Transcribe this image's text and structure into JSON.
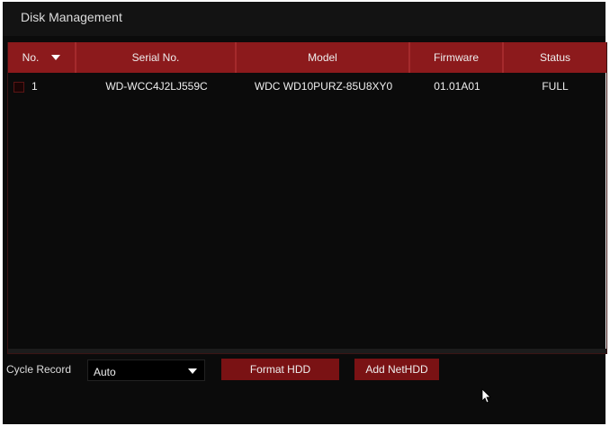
{
  "title": "Disk Management",
  "table": {
    "columns": [
      "No.",
      "Serial No.",
      "Model",
      "Firmware",
      "Status"
    ],
    "rows": [
      {
        "no": "1",
        "serial": "WD-WCC4J2LJ559C",
        "model": "WDC WD10PURZ-85U8XY0",
        "firmware": "01.01A01",
        "status": "FULL"
      }
    ]
  },
  "controls": {
    "cycle_record_label": "Cycle Record",
    "cycle_record_value": "Auto",
    "format_label": "Format HDD",
    "add_nethdd_label": "Add NetHDD"
  },
  "colors": {
    "accent": "#8c1a1c",
    "background": "#0b0b0b"
  }
}
